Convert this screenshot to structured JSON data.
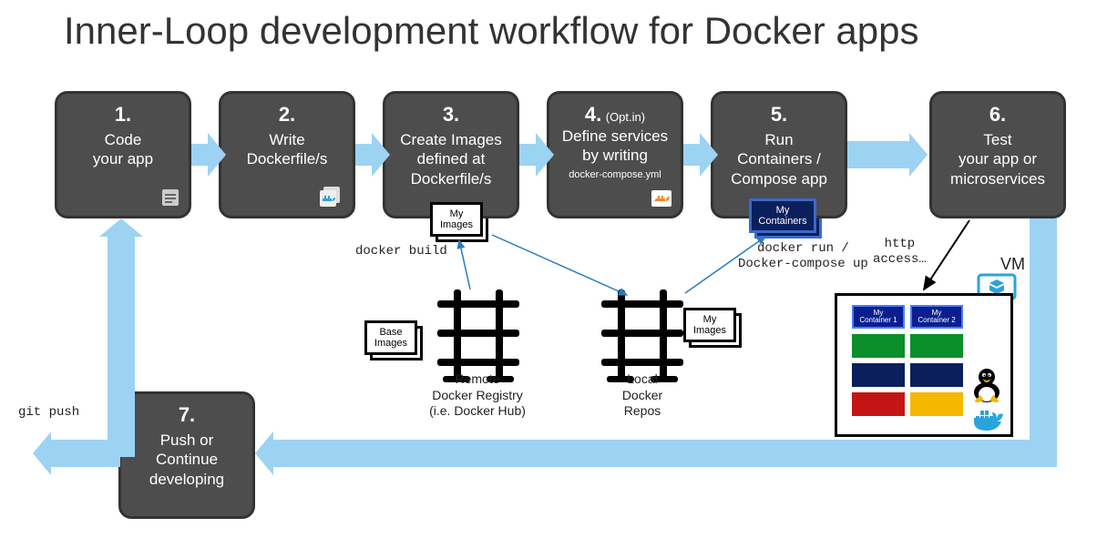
{
  "title": "Inner-Loop development workflow for Docker apps",
  "steps": [
    {
      "num": "1.",
      "text": "Code\nyour app"
    },
    {
      "num": "2.",
      "text": "Write\nDockerfile/s"
    },
    {
      "num": "3.",
      "text": "Create Images\ndefined at\nDockerfile/s"
    },
    {
      "num": "4.",
      "opt": "(Opt.in)",
      "text": "Define services\nby writing",
      "sub": "docker-compose.yml"
    },
    {
      "num": "5.",
      "text": "Run\nContainers /\nCompose app"
    },
    {
      "num": "6.",
      "text": "Test\nyour app or\nmicroservices"
    },
    {
      "num": "7.",
      "text": "Push or\nContinue\ndeveloping"
    }
  ],
  "mini": {
    "my_images_top": "My\nImages",
    "my_containers": "My\nContainers",
    "base_images": "Base\nImages",
    "my_images_local": "My\nImages"
  },
  "captions": {
    "remote_registry": "Remote\nDocker Registry\n(i.e. Docker Hub)",
    "local_repos": "Local\nDocker\nRepos",
    "docker_build": "docker build",
    "docker_run": "docker run /\nDocker-compose up",
    "http_access": "http\naccess…",
    "vm": "VM",
    "git_push": "git push"
  },
  "vm": {
    "c1": "My\nContainer 1",
    "c2": "My\nContainer 2"
  }
}
